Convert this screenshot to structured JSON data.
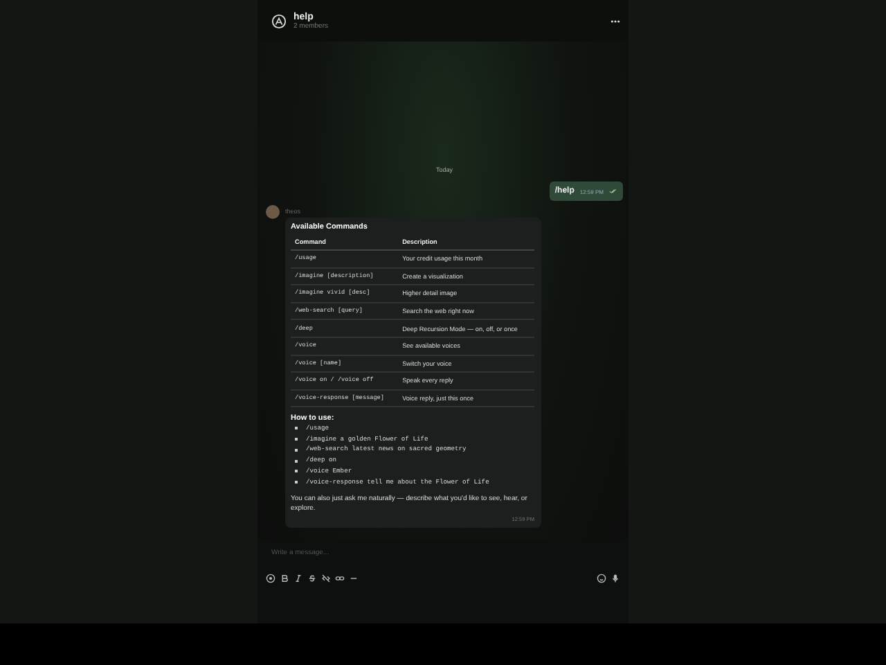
{
  "header": {
    "title": "help",
    "subtitle": "2 members"
  },
  "date_divider": "Today",
  "sent": {
    "text": "/help",
    "time": "12:59 PM"
  },
  "reply": {
    "sender": "theos",
    "title": "Available Commands",
    "table": {
      "columns": [
        "Command",
        "Description"
      ],
      "rows": [
        {
          "command": "/usage",
          "description": "Your credit usage this month"
        },
        {
          "command": "/imagine [description]",
          "description": "Create a visualization"
        },
        {
          "command": "/imagine vivid [desc]",
          "description": "Higher detail image"
        },
        {
          "command": "/web-search [query]",
          "description": "Search the web right now"
        },
        {
          "command": "/deep",
          "description": "Deep Recursion Mode — on, off, or once"
        },
        {
          "command": "/voice",
          "description": "See available voices"
        },
        {
          "command": "/voice [name]",
          "description": "Switch your voice"
        },
        {
          "command": "/voice on / /voice off",
          "description": "Speak every reply"
        },
        {
          "command": "/voice-response [message]",
          "description": "Voice reply, just this once"
        }
      ]
    },
    "howto_title": "How to use:",
    "examples": [
      "/usage",
      "/imagine a golden Flower of Life",
      "/web-search latest news on sacred geometry",
      "/deep on",
      "/voice Ember",
      "/voice-response tell me about the Flower of Life"
    ],
    "footer": "You can also just ask me naturally — describe what you'd like to see, hear, or explore.",
    "time": "12:59 PM"
  },
  "composer": {
    "placeholder": "Write a message..."
  }
}
